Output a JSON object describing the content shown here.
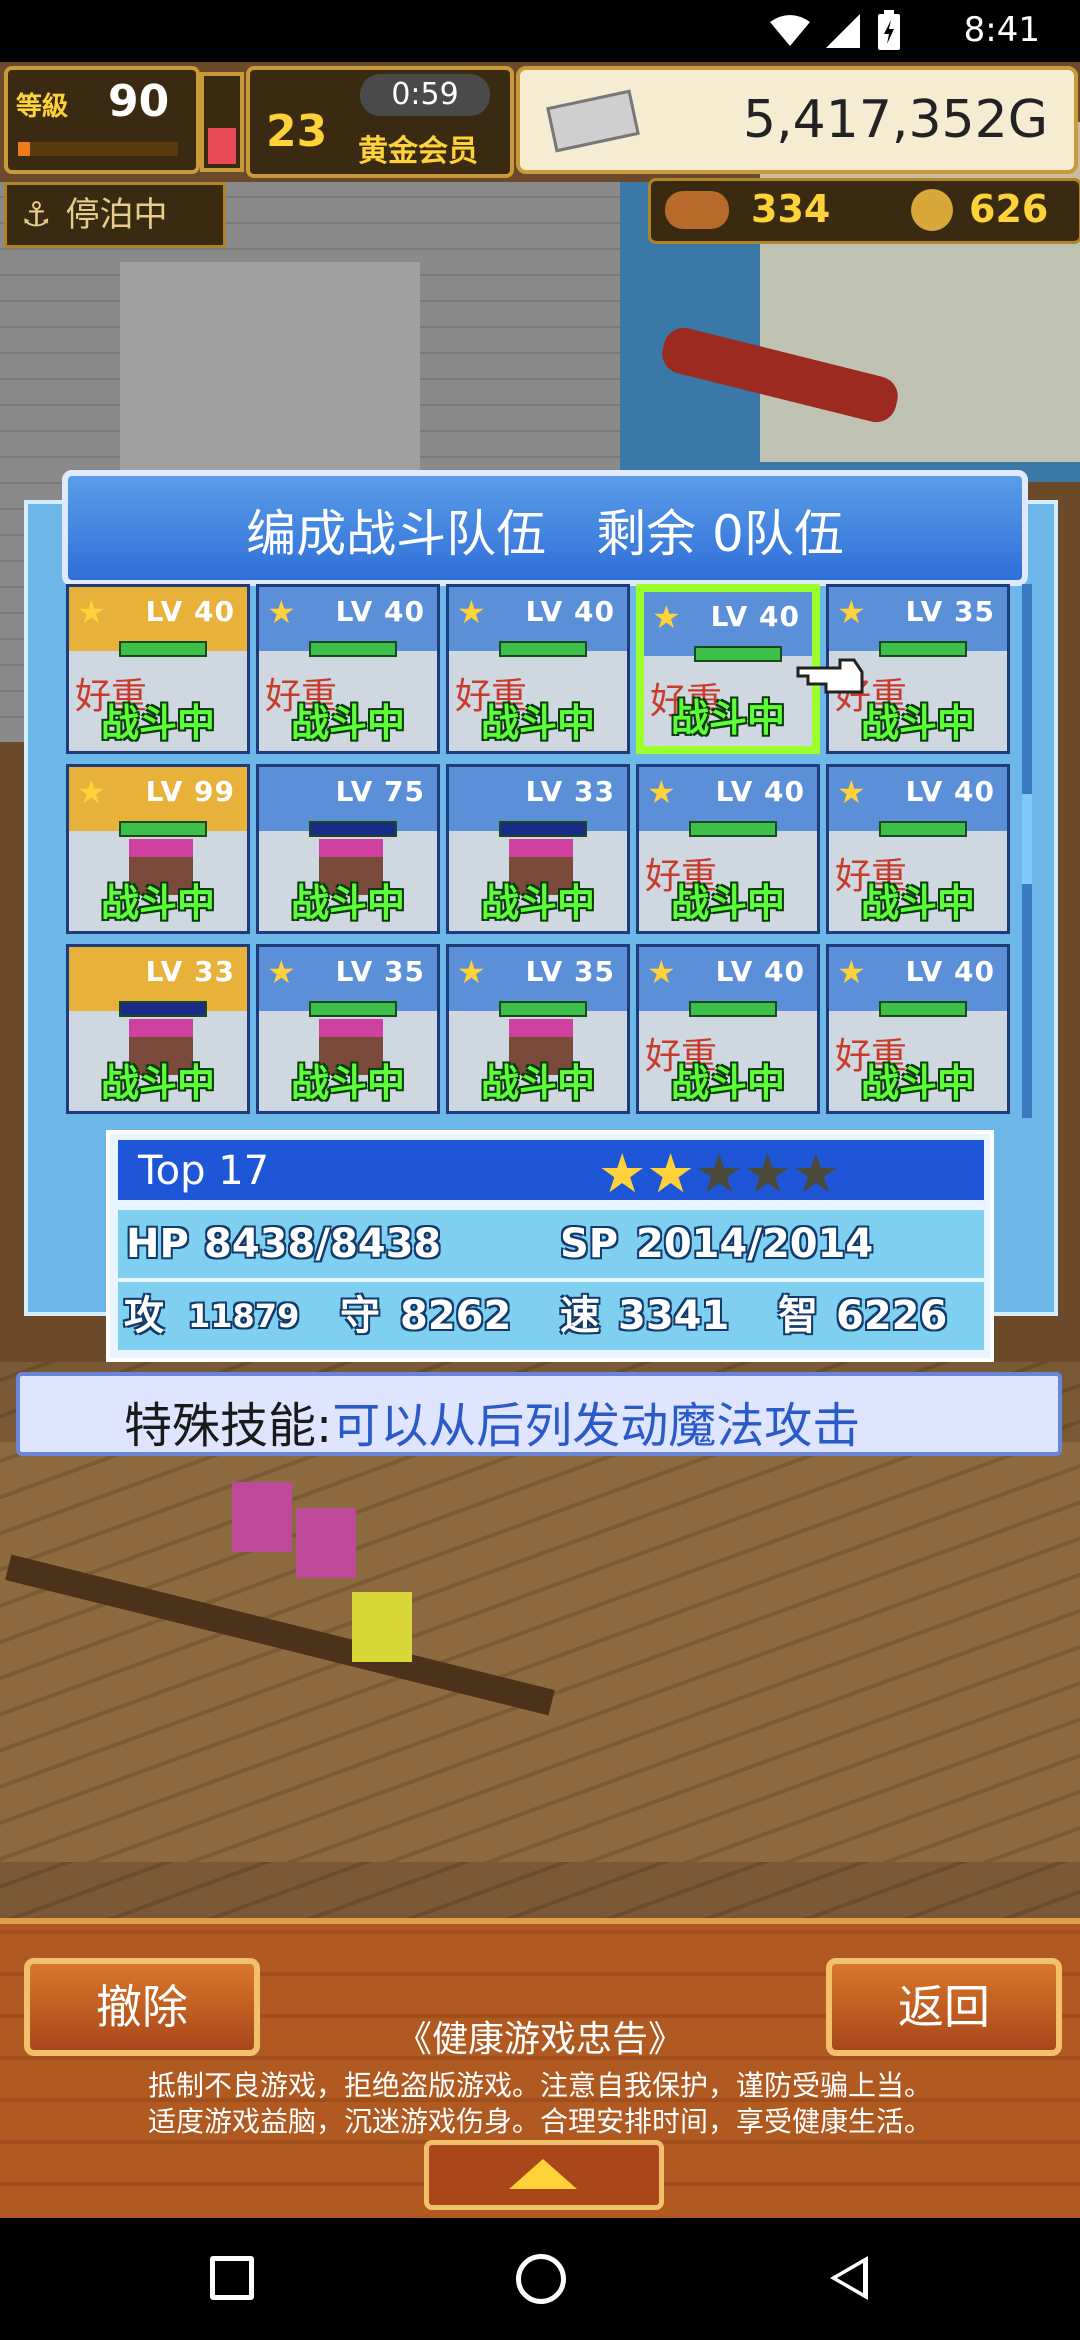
{
  "status_bar": {
    "time": "8:41"
  },
  "hud": {
    "level_label": "等級",
    "level_value": "90",
    "vip_number": "23",
    "vip_timer": "0:59",
    "vip_label": "黄金会员",
    "gold_amount": "5,417,352G",
    "anchor_label": "停泊中",
    "resource_a": "334",
    "resource_b": "626"
  },
  "panel": {
    "title": "编成战斗队伍　剩余 0队伍",
    "busy_text": "好重",
    "fight_text": "战斗中",
    "cells": [
      {
        "lv": "LV 40",
        "star": true,
        "gold": true,
        "busy": true,
        "hp_dark": false
      },
      {
        "lv": "LV 40",
        "star": true,
        "gold": false,
        "busy": true,
        "hp_dark": false
      },
      {
        "lv": "LV 40",
        "star": true,
        "gold": false,
        "busy": true,
        "hp_dark": false
      },
      {
        "lv": "LV 40",
        "star": true,
        "gold": false,
        "busy": true,
        "hp_dark": false,
        "selected": true
      },
      {
        "lv": "LV 35",
        "star": true,
        "gold": false,
        "busy": true,
        "hp_dark": false
      },
      {
        "lv": "LV 99",
        "star": true,
        "gold": true,
        "busy": false,
        "hp_dark": false
      },
      {
        "lv": "LV 75",
        "star": false,
        "gold": false,
        "busy": false,
        "hp_dark": true
      },
      {
        "lv": "LV 33",
        "star": false,
        "gold": false,
        "busy": false,
        "hp_dark": true
      },
      {
        "lv": "LV 40",
        "star": true,
        "gold": false,
        "busy": true,
        "hp_dark": false
      },
      {
        "lv": "LV 40",
        "star": true,
        "gold": false,
        "busy": true,
        "hp_dark": false
      },
      {
        "lv": "LV 33",
        "star": false,
        "gold": true,
        "busy": false,
        "hp_dark": true
      },
      {
        "lv": "LV 35",
        "star": true,
        "gold": false,
        "busy": false,
        "hp_dark": false
      },
      {
        "lv": "LV 35",
        "star": true,
        "gold": false,
        "busy": false,
        "hp_dark": false
      },
      {
        "lv": "LV 40",
        "star": true,
        "gold": false,
        "busy": true,
        "hp_dark": false
      },
      {
        "lv": "LV 40",
        "star": true,
        "gold": false,
        "busy": true,
        "hp_dark": false
      }
    ]
  },
  "stats": {
    "name": "Top 17",
    "stars_filled": 2,
    "stars_total": 5,
    "hp_label": "HP",
    "hp_value": "8438/8438",
    "sp_label": "SP",
    "sp_value": "2014/2014",
    "atk_label": "攻",
    "atk_value": "11879",
    "def_label": "守",
    "def_value": "8262",
    "spd_label": "速",
    "spd_value": "3341",
    "int_label": "智",
    "int_value": "6226"
  },
  "skill": {
    "label": "特殊技能:",
    "text": "可以从后列发动魔法攻击"
  },
  "bottom": {
    "remove_button": "撤除",
    "back_button": "返回",
    "notice_title": "《健康游戏忠告》",
    "notice_line1": "抵制不良游戏，拒绝盗版游戏。注意自我保护，谨防受骗上当。",
    "notice_line2": "适度游戏益脑，沉迷游戏伤身。合理安排时间，享受健康生活。"
  },
  "icons": {
    "wifi": "wifi-icon",
    "signal": "signal-icon",
    "battery": "battery-icon",
    "anchor": "anchor-icon",
    "gold_bar": "gold-bar-icon",
    "pointer": "hand-pointer-icon"
  },
  "colors": {
    "fight_green": "#5cff3a",
    "panel_blue": "#6db6e8",
    "skill_blue": "#2a5ac8",
    "selected_border": "#9aff2a"
  }
}
